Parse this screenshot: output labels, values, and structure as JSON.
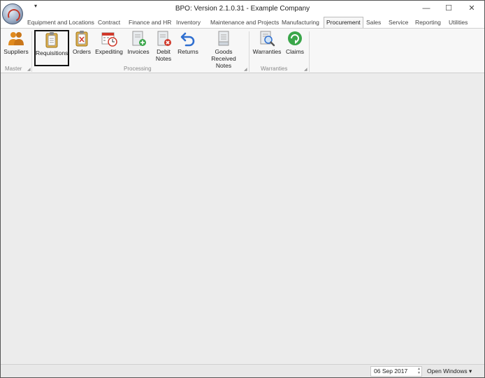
{
  "window": {
    "title": "BPO: Version 2.1.0.31 - Example Company",
    "qat_glyph": "▾",
    "min_glyph": "—",
    "max_glyph": "☐",
    "close_glyph": "✕"
  },
  "tabs": [
    {
      "label": "Equipment and Locations"
    },
    {
      "label": "Contract"
    },
    {
      "label": "Finance and HR"
    },
    {
      "label": "Inventory"
    },
    {
      "label": "Maintenance and Projects"
    },
    {
      "label": "Manufacturing"
    },
    {
      "label": "Procurement",
      "active": true
    },
    {
      "label": "Sales"
    },
    {
      "label": "Service"
    },
    {
      "label": "Reporting"
    },
    {
      "label": "Utilities"
    }
  ],
  "ribbon": {
    "groups": [
      {
        "label": "Master"
      },
      {
        "label": "Processing"
      },
      {
        "label": "Warranties"
      }
    ],
    "buttons": [
      {
        "label": "Suppliers",
        "icon": "suppliers-icon"
      },
      {
        "label": "Requisitions",
        "icon": "clipboard-icon",
        "selected": true
      },
      {
        "label": "Orders",
        "icon": "order-icon"
      },
      {
        "label": "Expediting",
        "icon": "calendar-clock-icon"
      },
      {
        "label": "Invoices",
        "icon": "invoice-add-icon"
      },
      {
        "label": "Debit\nNotes",
        "line1": "Debit",
        "line2": "Notes",
        "icon": "debit-notes-icon"
      },
      {
        "label": "Returns",
        "icon": "return-arrow-icon"
      },
      {
        "label": "Goods Received\nNotes",
        "line1": "Goods Received",
        "line2": "Notes",
        "icon": "goods-received-icon"
      },
      {
        "label": "Warranties",
        "icon": "warranty-search-icon"
      },
      {
        "label": "Claims",
        "icon": "claims-refresh-icon"
      }
    ],
    "corner_glyph": "◢"
  },
  "statusbar": {
    "date": "06 Sep 2017",
    "open_windows": "Open Windows ▾"
  },
  "colors": {
    "accent_blue": "#2f6fd0",
    "icon_orange": "#e08a1e",
    "icon_green": "#3aa64a",
    "icon_red": "#d0392b"
  }
}
